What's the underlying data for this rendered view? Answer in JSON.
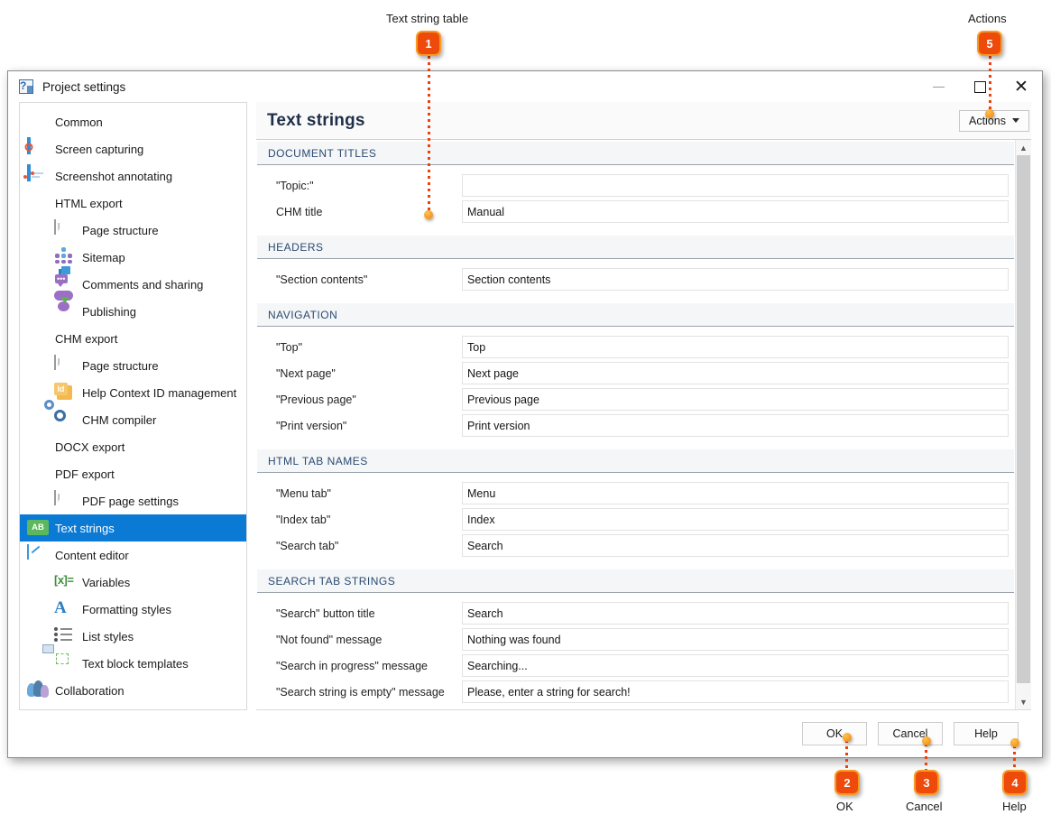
{
  "annotations": [
    {
      "number": "1",
      "label": "Text string table"
    },
    {
      "number": "5",
      "label": "Actions"
    },
    {
      "number": "2",
      "label": "OK"
    },
    {
      "number": "3",
      "label": "Cancel"
    },
    {
      "number": "4",
      "label": "Help"
    }
  ],
  "window": {
    "title": "Project settings",
    "minimize_label": "—",
    "maximize_label": "□",
    "close_label": "✕"
  },
  "sidebar": {
    "items": [
      {
        "label": "Common",
        "icon": "gear-icon",
        "level": 0,
        "selected": false
      },
      {
        "label": "Screen capturing",
        "icon": "screen-capture-icon",
        "level": 0,
        "selected": false
      },
      {
        "label": "Screenshot annotating",
        "icon": "screenshot-annotate-icon",
        "level": 0,
        "selected": false
      },
      {
        "label": "HTML export",
        "icon": "html-document-icon",
        "level": 0,
        "selected": false
      },
      {
        "label": "Page structure",
        "icon": "page-structure-icon",
        "level": 1,
        "selected": false
      },
      {
        "label": "Sitemap",
        "icon": "sitemap-icon",
        "level": 1,
        "selected": false
      },
      {
        "label": "Comments and sharing",
        "icon": "comment-thumbsup-icon",
        "level": 1,
        "selected": false
      },
      {
        "label": "Publishing",
        "icon": "cloud-upload-icon",
        "level": 1,
        "selected": false
      },
      {
        "label": "CHM export",
        "icon": "question-document-icon",
        "level": 0,
        "selected": false
      },
      {
        "label": "Page structure",
        "icon": "page-structure-icon",
        "level": 1,
        "selected": false
      },
      {
        "label": "Help Context ID management",
        "icon": "id-card-icon",
        "level": 1,
        "selected": false
      },
      {
        "label": "CHM compiler",
        "icon": "gears-icon",
        "level": 1,
        "selected": false
      },
      {
        "label": "DOCX export",
        "icon": "word-document-icon",
        "level": 0,
        "selected": false
      },
      {
        "label": "PDF export",
        "icon": "pdf-document-icon",
        "level": 0,
        "selected": false
      },
      {
        "label": "PDF page settings",
        "icon": "page-structure-icon",
        "level": 1,
        "selected": false
      },
      {
        "label": "Text strings",
        "icon": "ab-text-icon",
        "level": 0,
        "selected": true
      },
      {
        "label": "Content editor",
        "icon": "content-editor-icon",
        "level": 0,
        "selected": false
      },
      {
        "label": "Variables",
        "icon": "variables-icon",
        "level": 1,
        "selected": false
      },
      {
        "label": "Formatting styles",
        "icon": "formatting-styles-icon",
        "level": 1,
        "selected": false
      },
      {
        "label": "List styles",
        "icon": "list-styles-icon",
        "level": 1,
        "selected": false
      },
      {
        "label": "Text block templates",
        "icon": "text-block-templates-icon",
        "level": 1,
        "selected": false
      },
      {
        "label": "Collaboration",
        "icon": "collaboration-icon",
        "level": 0,
        "selected": false
      }
    ]
  },
  "content": {
    "page_title": "Text strings",
    "actions_button": "Actions",
    "sections": [
      {
        "title": "DOCUMENT TITLES",
        "rows": [
          {
            "label": "\"Topic:\"",
            "value": ""
          },
          {
            "label": "CHM title",
            "value": "Manual"
          }
        ]
      },
      {
        "title": "HEADERS",
        "rows": [
          {
            "label": "\"Section contents\"",
            "value": "Section contents"
          }
        ]
      },
      {
        "title": "NAVIGATION",
        "rows": [
          {
            "label": "\"Top\"",
            "value": "Top"
          },
          {
            "label": "\"Next page\"",
            "value": "Next page"
          },
          {
            "label": "\"Previous page\"",
            "value": "Previous page"
          },
          {
            "label": "\"Print version\"",
            "value": "Print version"
          }
        ]
      },
      {
        "title": "HTML TAB NAMES",
        "rows": [
          {
            "label": "\"Menu tab\"",
            "value": "Menu"
          },
          {
            "label": "\"Index tab\"",
            "value": "Index"
          },
          {
            "label": "\"Search tab\"",
            "value": "Search"
          }
        ]
      },
      {
        "title": "SEARCH TAB STRINGS",
        "rows": [
          {
            "label": "\"Search\" button title",
            "value": "Search"
          },
          {
            "label": "\"Not found\" message",
            "value": "Nothing was found"
          },
          {
            "label": "\"Search in progress\" message",
            "value": "Searching..."
          },
          {
            "label": "\"Search string is empty\" message",
            "value": "Please, enter a string for search!"
          }
        ]
      }
    ]
  },
  "footer": {
    "ok": "OK",
    "cancel": "Cancel",
    "help": "Help"
  },
  "colors": {
    "accent_selected": "#0a7ad4",
    "callout_fill": "#ed4a0b",
    "callout_border": "#f79b23",
    "title_color": "#1f2f4a",
    "section_header_text": "#2b4a6f"
  }
}
